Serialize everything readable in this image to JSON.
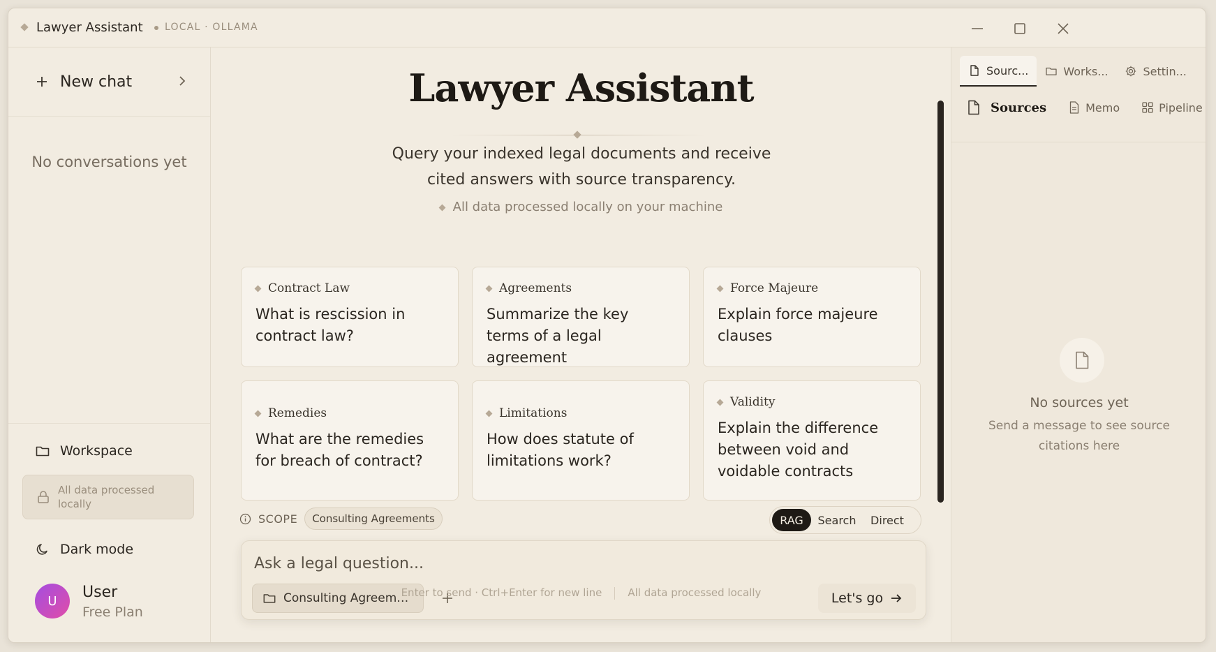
{
  "window": {
    "title": "Lawyer Assistant",
    "subtitle": "LOCAL · OLLAMA"
  },
  "sidebar": {
    "new_chat": "New chat",
    "empty_text": "No conversations yet",
    "workspace": "Workspace",
    "local_notice": "All data processed locally",
    "dark_mode": "Dark mode",
    "user": {
      "initial": "U",
      "name": "User",
      "plan": "Free Plan"
    }
  },
  "hero": {
    "title": "Lawyer Assistant",
    "description": "Query your indexed legal documents and receive cited answers with source transparency.",
    "note": "All data processed locally on your machine"
  },
  "cards": [
    {
      "category": "Contract Law",
      "question": "What is rescission in contract law?"
    },
    {
      "category": "Agreements",
      "question": "Summarize the key terms of a legal agreement"
    },
    {
      "category": "Force Majeure",
      "question": "Explain force majeure clauses"
    },
    {
      "category": "Remedies",
      "question": "What are the remedies for breach of contract?"
    },
    {
      "category": "Limitations",
      "question": "How does statute of limitations work?"
    },
    {
      "category": "Validity",
      "question": "Explain the difference between void and voidable contracts"
    }
  ],
  "scope": {
    "label": "SCOPE",
    "chip": "Consulting Agreements"
  },
  "modes": [
    "RAG",
    "Search",
    "Direct"
  ],
  "active_mode": "RAG",
  "composer": {
    "placeholder": "Ask a legal question...",
    "workspace_chip": "Consulting Agreeme...",
    "submit": "Let's go"
  },
  "footnote": {
    "hint": "Enter to send · Ctrl+Enter for new line",
    "local": "All data processed locally"
  },
  "right_panel": {
    "tabs": [
      "Sourc...",
      "Works...",
      "Settin..."
    ],
    "subtabs": [
      "Sources",
      "Memo",
      "Pipeline"
    ],
    "empty_title": "No sources yet",
    "empty_desc": "Send a message to see source citations here"
  },
  "colors": {
    "background": "#f2ece1",
    "accent_dark": "#1e1a15",
    "avatar_gradient_start": "#a44de0",
    "avatar_gradient_end": "#e04da8"
  }
}
